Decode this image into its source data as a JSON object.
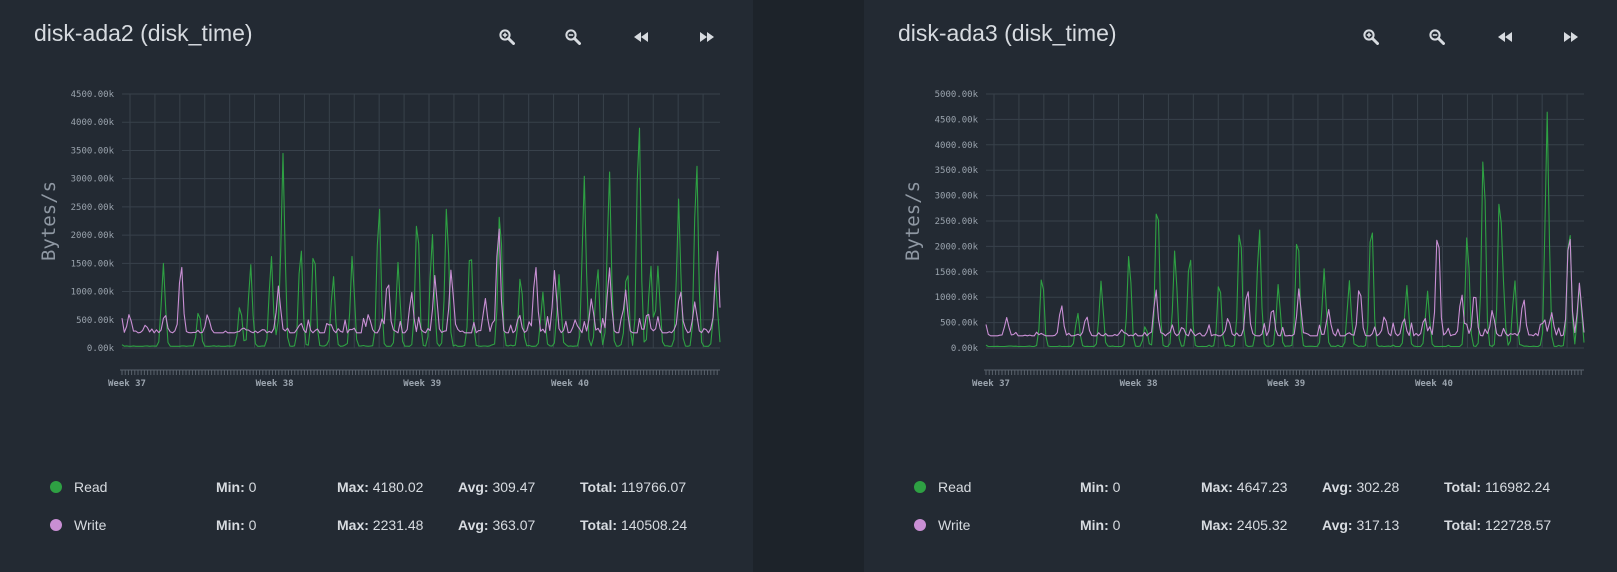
{
  "colors": {
    "read": "#2ea043",
    "write": "#c98fd4",
    "grid": "#38414b",
    "text": "#d7dbe0",
    "axis": "#9aa3ad"
  },
  "toolbar": {
    "icons": [
      "zoom-in-icon",
      "zoom-out-icon",
      "rewind-icon",
      "fast-forward-icon"
    ]
  },
  "stat_labels": {
    "min": "Min:",
    "max": "Max:",
    "avg": "Avg:",
    "total": "Total:"
  },
  "panels": [
    {
      "title": "disk-ada2 (disk_time)",
      "legend": [
        {
          "name": "Read",
          "min": "0",
          "max": "4180.02",
          "avg": "309.47",
          "total": "119766.07"
        },
        {
          "name": "Write",
          "min": "0",
          "max": "2231.48",
          "avg": "363.07",
          "total": "140508.24"
        }
      ]
    },
    {
      "title": "disk-ada3 (disk_time)",
      "legend": [
        {
          "name": "Read",
          "min": "0",
          "max": "4647.23",
          "avg": "302.28",
          "total": "116982.24"
        },
        {
          "name": "Write",
          "min": "0",
          "max": "2405.32",
          "avg": "317.13",
          "total": "122728.57"
        }
      ]
    }
  ],
  "chart_data": [
    {
      "type": "line",
      "title": "disk-ada2 (disk_time)",
      "ylabel": "Bytes/s",
      "ylim": [
        0,
        4500
      ],
      "yticks": [
        0,
        500,
        1000,
        1500,
        2000,
        2500,
        3000,
        3500,
        4000,
        4500
      ],
      "ytick_labels": [
        "0.00k",
        "500.00k",
        "1000.00k",
        "1500.00k",
        "2000.00k",
        "2500.00k",
        "3000.00k",
        "3500.00k",
        "4000.00k",
        "4500.00k"
      ],
      "xlim": [
        0,
        4.05
      ],
      "xticks": [
        0,
        1,
        2,
        3
      ],
      "xtick_labels": [
        "Week 37",
        "Week 38",
        "Week 39",
        "Week 40"
      ],
      "grid": true,
      "series": [
        {
          "name": "Read",
          "baseline": 30,
          "peaks": [
            [
              0.28,
              1500
            ],
            [
              0.52,
              680
            ],
            [
              0.8,
              780
            ],
            [
              0.87,
              1500
            ],
            [
              1.01,
              1650
            ],
            [
              1.06,
              500
            ],
            [
              1.09,
              3450
            ],
            [
              1.21,
              1850
            ],
            [
              1.3,
              1850
            ],
            [
              1.43,
              1300
            ],
            [
              1.56,
              1650
            ],
            [
              1.74,
              2620
            ],
            [
              1.87,
              1520
            ],
            [
              2.0,
              2420
            ],
            [
              2.1,
              2060
            ],
            [
              2.2,
              2560
            ],
            [
              2.36,
              1870
            ],
            [
              2.56,
              2530
            ],
            [
              2.7,
              1320
            ],
            [
              2.85,
              990
            ],
            [
              2.96,
              1300
            ],
            [
              3.13,
              3050
            ],
            [
              3.22,
              1470
            ],
            [
              3.3,
              3170
            ],
            [
              3.42,
              1480
            ],
            [
              3.5,
              4180
            ],
            [
              3.58,
              1480
            ],
            [
              3.63,
              1450
            ],
            [
              3.77,
              2640
            ],
            [
              3.89,
              3400
            ],
            [
              4.02,
              1200
            ]
          ]
        },
        {
          "name": "Write",
          "baseline": 270,
          "peaks": [
            [
              0.05,
              600
            ],
            [
              0.16,
              410
            ],
            [
              0.29,
              610
            ],
            [
              0.4,
              1520
            ],
            [
              0.58,
              600
            ],
            [
              0.82,
              360
            ],
            [
              1.06,
              1100
            ],
            [
              1.21,
              450
            ],
            [
              1.41,
              440
            ],
            [
              1.67,
              600
            ],
            [
              1.8,
              1250
            ],
            [
              1.96,
              1000
            ],
            [
              2.12,
              1290
            ],
            [
              2.23,
              1400
            ],
            [
              2.46,
              880
            ],
            [
              2.55,
              2231
            ],
            [
              2.69,
              600
            ],
            [
              2.8,
              1480
            ],
            [
              2.93,
              1380
            ],
            [
              3.07,
              500
            ],
            [
              3.18,
              880
            ],
            [
              3.3,
              1440
            ],
            [
              3.41,
              1030
            ],
            [
              3.56,
              650
            ],
            [
              3.78,
              1050
            ],
            [
              3.88,
              820
            ],
            [
              4.03,
              1800
            ]
          ]
        }
      ]
    },
    {
      "type": "line",
      "title": "disk-ada3 (disk_time)",
      "ylabel": "Bytes/s",
      "ylim": [
        0,
        5000
      ],
      "yticks": [
        0,
        500,
        1000,
        1500,
        2000,
        2500,
        3000,
        3500,
        4000,
        4500,
        5000
      ],
      "ytick_labels": [
        "0.00k",
        "500.00k",
        "1000.00k",
        "1500.00k",
        "2000.00k",
        "2500.00k",
        "3000.00k",
        "3500.00k",
        "4000.00k",
        "4500.00k",
        "5000.00k"
      ],
      "xlim": [
        0,
        4.05
      ],
      "xticks": [
        0,
        1,
        2,
        3
      ],
      "xtick_labels": [
        "Week 37",
        "Week 38",
        "Week 39",
        "Week 40"
      ],
      "grid": true,
      "series": [
        {
          "name": "Read",
          "baseline": 30,
          "peaks": [
            [
              0.38,
              1500
            ],
            [
              0.62,
              700
            ],
            [
              0.78,
              1320
            ],
            [
              0.97,
              1900
            ],
            [
              1.08,
              450
            ],
            [
              1.16,
              3100
            ],
            [
              1.28,
              1950
            ],
            [
              1.38,
              1950
            ],
            [
              1.58,
              1380
            ],
            [
              1.72,
              2530
            ],
            [
              1.85,
              2420
            ],
            [
              1.98,
              1260
            ],
            [
              2.11,
              2380
            ],
            [
              2.29,
              1560
            ],
            [
              2.46,
              1330
            ],
            [
              2.61,
              2620
            ],
            [
              2.85,
              1230
            ],
            [
              2.99,
              1120
            ],
            [
              3.26,
              2300
            ],
            [
              3.37,
              4000
            ],
            [
              3.48,
              3200
            ],
            [
              3.5,
              1400
            ],
            [
              3.58,
              1350
            ],
            [
              3.8,
              4650
            ],
            [
              3.95,
              2520
            ],
            [
              4.02,
              1250
            ]
          ]
        },
        {
          "name": "Write",
          "baseline": 240,
          "peaks": [
            [
              0.14,
              600
            ],
            [
              0.51,
              860
            ],
            [
              0.68,
              640
            ],
            [
              0.92,
              360
            ],
            [
              1.15,
              1160
            ],
            [
              1.33,
              420
            ],
            [
              1.64,
              600
            ],
            [
              1.77,
              1200
            ],
            [
              1.94,
              820
            ],
            [
              2.12,
              1170
            ],
            [
              2.32,
              760
            ],
            [
              2.53,
              1250
            ],
            [
              2.7,
              640
            ],
            [
              2.83,
              600
            ],
            [
              2.97,
              610
            ],
            [
              3.06,
              2420
            ],
            [
              3.22,
              1090
            ],
            [
              3.31,
              1150
            ],
            [
              3.43,
              750
            ],
            [
              3.64,
              1000
            ],
            [
              3.78,
              580
            ],
            [
              3.83,
              700
            ],
            [
              3.95,
              2400
            ],
            [
              4.02,
              1280
            ]
          ]
        }
      ]
    }
  ]
}
